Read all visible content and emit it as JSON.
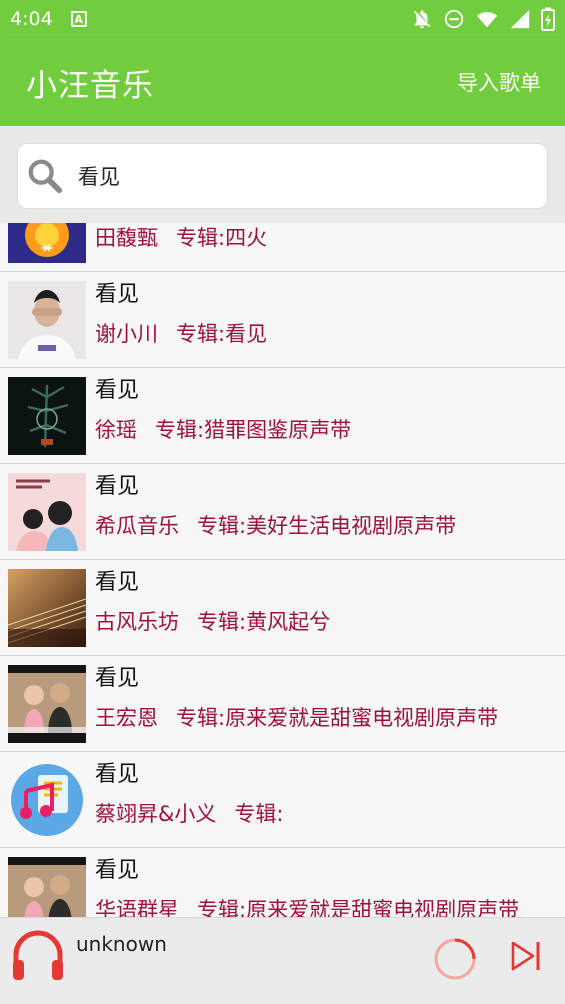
{
  "status_bar": {
    "time": "4:04",
    "a_badge": "A"
  },
  "app_bar": {
    "title": "小汪音乐",
    "action": "导入歌单"
  },
  "search": {
    "value": "看见"
  },
  "rows": [
    {
      "title": "",
      "artist": "田馥甄",
      "album": "专辑:四火"
    },
    {
      "title": "看见",
      "artist": "谢小川",
      "album": "专辑:看见"
    },
    {
      "title": "看见",
      "artist": "徐瑶",
      "album": "专辑:猎罪图鉴原声带"
    },
    {
      "title": "看见",
      "artist": "希瓜音乐",
      "album": "专辑:美好生活电视剧原声带"
    },
    {
      "title": "看见",
      "artist": "古风乐坊",
      "album": "专辑:黄风起兮"
    },
    {
      "title": "看见",
      "artist": "王宏恩",
      "album": "专辑:原来爱就是甜蜜电视剧原声带"
    },
    {
      "title": "看见",
      "artist": "蔡翊昇&小义",
      "album": "专辑:"
    },
    {
      "title": "看见",
      "artist": "华语群星",
      "album": "专辑:原来爱就是甜蜜电视剧原声带"
    }
  ],
  "player": {
    "now_playing": "unknown"
  },
  "colors": {
    "accent": "#72cd3e",
    "subtitle": "#a0103a",
    "player_icon": "#e53935"
  }
}
